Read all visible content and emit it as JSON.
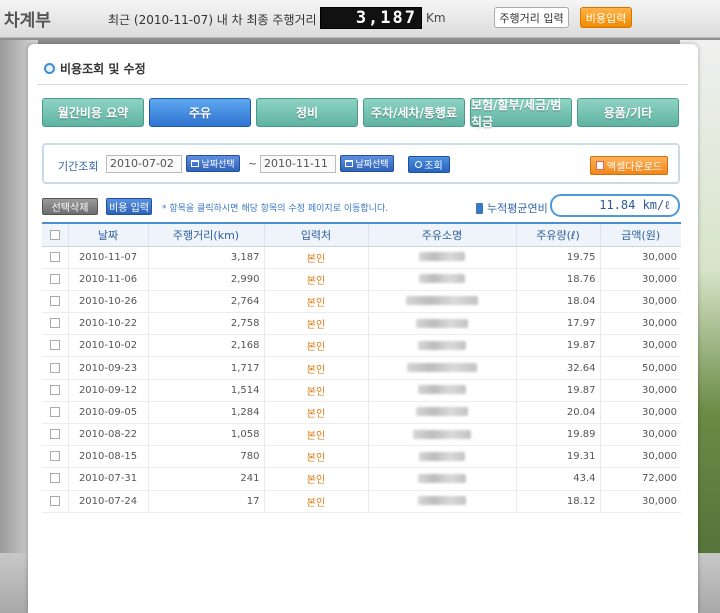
{
  "app": {
    "title": "차계부",
    "mileage_text": "최근 (2010-11-07) 내 차 최종 주행거리 :",
    "odometer_value": "3,187",
    "odometer_unit": "Km",
    "mileage_button": "주행거리 입력",
    "cost_button": "비용입력"
  },
  "section": {
    "title": "비용조회 및 수정"
  },
  "tabs": [
    {
      "label": "월간비용 요약",
      "active": false
    },
    {
      "label": "주유",
      "active": true
    },
    {
      "label": "정비",
      "active": false
    },
    {
      "label": "주차/세차/통행료",
      "active": false
    },
    {
      "label": "보험/할부/세금/범칙금",
      "active": false
    },
    {
      "label": "용품/기타",
      "active": false
    }
  ],
  "filter": {
    "label": "기간조회",
    "date_from": "2010-07-02",
    "date_to": "2010-11-11",
    "date_select_label": "날짜선택",
    "tilde": "~",
    "search_label": "조회",
    "excel_label": "엑셀다운로드"
  },
  "actions": {
    "delete_label": "선택삭제",
    "add_label": "비용 입력",
    "notice": "* 항목을 클릭하시면 해당 항목의 수정 페이지로 이동합니다.",
    "avg_label": "누적평균연비",
    "avg_value": "11.84 km/ℓ"
  },
  "table": {
    "headers": [
      "날짜",
      "주행거리(km)",
      "입력처",
      "주유소명",
      "주유량(ℓ)",
      "금액(원)"
    ],
    "rows": [
      {
        "date": "2010-11-07",
        "distance": "3,187",
        "source": "본인",
        "amount_l": "19.75",
        "price": "30,000"
      },
      {
        "date": "2010-11-06",
        "distance": "2,990",
        "source": "본인",
        "amount_l": "18.76",
        "price": "30,000"
      },
      {
        "date": "2010-10-26",
        "distance": "2,764",
        "source": "본인",
        "amount_l": "18.04",
        "price": "30,000"
      },
      {
        "date": "2010-10-22",
        "distance": "2,758",
        "source": "본인",
        "amount_l": "17.97",
        "price": "30,000"
      },
      {
        "date": "2010-10-02",
        "distance": "2,168",
        "source": "본인",
        "amount_l": "19.87",
        "price": "30,000"
      },
      {
        "date": "2010-09-23",
        "distance": "1,717",
        "source": "본인",
        "amount_l": "32.64",
        "price": "50,000"
      },
      {
        "date": "2010-09-12",
        "distance": "1,514",
        "source": "본인",
        "amount_l": "19.87",
        "price": "30,000"
      },
      {
        "date": "2010-09-05",
        "distance": "1,284",
        "source": "본인",
        "amount_l": "20.04",
        "price": "30,000"
      },
      {
        "date": "2010-08-22",
        "distance": "1,058",
        "source": "본인",
        "amount_l": "19.89",
        "price": "30,000"
      },
      {
        "date": "2010-08-15",
        "distance": "780",
        "source": "본인",
        "amount_l": "19.31",
        "price": "30,000"
      },
      {
        "date": "2010-07-31",
        "distance": "241",
        "source": "본인",
        "amount_l": "43.4",
        "price": "72,000"
      },
      {
        "date": "2010-07-24",
        "distance": "17",
        "source": "본인",
        "amount_l": "18.12",
        "price": "30,000"
      }
    ]
  }
}
